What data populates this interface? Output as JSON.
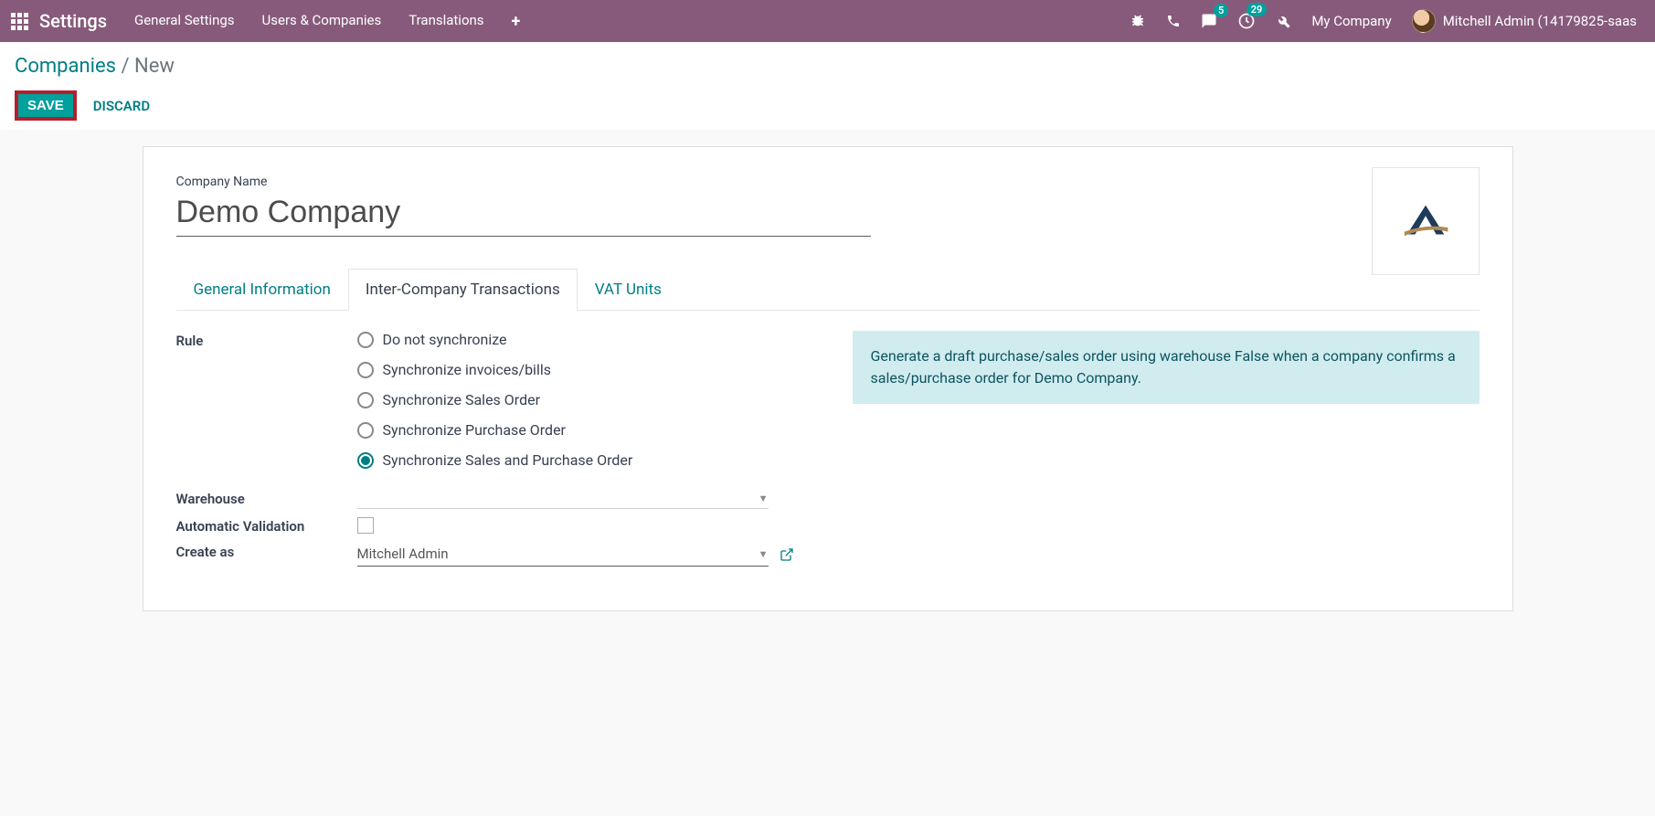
{
  "topbar": {
    "app_title": "Settings",
    "menu": [
      "General Settings",
      "Users & Companies",
      "Translations"
    ],
    "messages_badge": "5",
    "activities_badge": "29",
    "company_name": "My Company",
    "user_name": "Mitchell Admin (14179825-saas"
  },
  "breadcrumb": {
    "link": "Companies",
    "current": "New"
  },
  "actions": {
    "save": "SAVE",
    "discard": "DISCARD"
  },
  "form": {
    "company_name_label": "Company Name",
    "company_name_value": "Demo Company"
  },
  "tabs": [
    "General Information",
    "Inter-Company Transactions",
    "VAT Units"
  ],
  "active_tab": 1,
  "labels": {
    "rule": "Rule",
    "warehouse": "Warehouse",
    "auto_validation": "Automatic Validation",
    "create_as": "Create as"
  },
  "rule_options": [
    "Do not synchronize",
    "Synchronize invoices/bills",
    "Synchronize Sales Order",
    "Synchronize Purchase Order",
    "Synchronize Sales and Purchase Order"
  ],
  "rule_selected": 4,
  "warehouse_value": "",
  "auto_validation_checked": false,
  "create_as_value": "Mitchell Admin",
  "info_text": "Generate a draft purchase/sales order using warehouse False when a company confirms a sales/purchase order for Demo Company."
}
